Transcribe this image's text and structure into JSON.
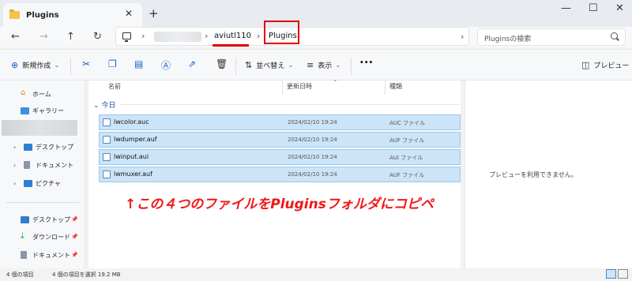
{
  "window": {
    "tab_title": "Plugins",
    "close_tab": "✕",
    "new_tab": "+",
    "minimize": "—",
    "maximize": "☐",
    "close": "✕"
  },
  "nav": {
    "back": "←",
    "forward": "→",
    "up": "↑",
    "refresh": "↻"
  },
  "address": {
    "separator": "›",
    "crumbs": [
      "aviutl110",
      "Plugins"
    ],
    "dropdown": "›"
  },
  "search": {
    "placeholder": "Pluginsの検索"
  },
  "commands": {
    "new_label": "新規作成",
    "sort_label": "並べ替え",
    "view_label": "表示",
    "more": "•••",
    "preview_label": "プレビュー"
  },
  "sidebar": {
    "items": [
      {
        "label": "ホーム"
      },
      {
        "label": "ギャラリー"
      },
      {
        "label": "デスクトップ"
      },
      {
        "label": "ドキュメント"
      },
      {
        "label": "ピクチャ"
      },
      {
        "label": "デスクトップ"
      },
      {
        "label": "ダウンロード"
      },
      {
        "label": "ドキュメント"
      }
    ]
  },
  "columns": {
    "name": "名前",
    "modified": "更新日時",
    "type": "種類"
  },
  "group": {
    "label": "今日"
  },
  "files": [
    {
      "name": "lwcolor.auc",
      "date": "2024/02/10 19:24",
      "type": "AUC ファイル"
    },
    {
      "name": "lwdumper.auf",
      "date": "2024/02/10 19:24",
      "type": "AUF ファイル"
    },
    {
      "name": "lwinput.aui",
      "date": "2024/02/10 19:24",
      "type": "AUI ファイル"
    },
    {
      "name": "lwmuxer.auf",
      "date": "2024/02/10 19:24",
      "type": "AUF ファイル"
    }
  ],
  "annotation": {
    "text": "↑この４つのファイルをPluginsフォルダにコピペ",
    "color": "#f01818"
  },
  "preview": {
    "message": "プレビューを利用できません。"
  },
  "status": {
    "count": "4 個の項目",
    "selected": "4 個の項目を選択  19.2 MB"
  },
  "colors": {
    "accent": "#1a63c9",
    "selection": "#cce4f7",
    "highlight_red": "#e00000"
  }
}
